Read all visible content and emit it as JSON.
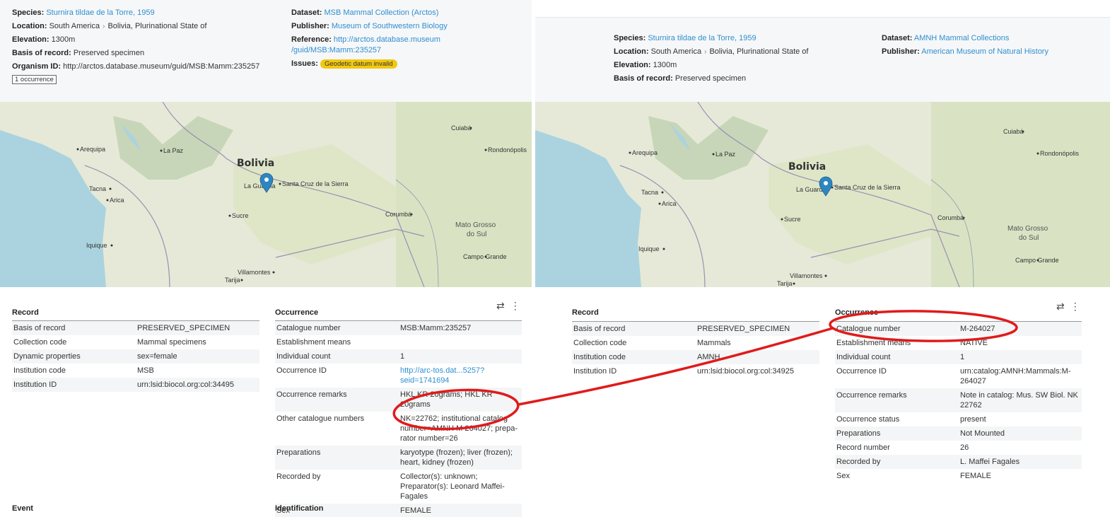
{
  "left": {
    "summary": {
      "species_label": "Species:",
      "species_value": "Sturnira tildae de la Torre, 1959",
      "location_label": "Location:",
      "location_continent": "South America",
      "location_country": "Bolivia, Plurinational State of",
      "elevation_label": "Elevation:",
      "elevation_value": "1300m",
      "basis_label": "Basis of record:",
      "basis_value": "Preserved specimen",
      "organism_label": "Organism ID:",
      "organism_value": "http://arctos.database.museum/guid/MSB:Mamm:235257",
      "count_badge": "1 occurrence",
      "dataset_label": "Dataset:",
      "dataset_value": "MSB Mammal Collection (Arctos)",
      "publisher_label": "Publisher:",
      "publisher_value": "Museum of Southwestern Biology",
      "reference_label": "Reference:",
      "reference_line1": "http://arctos.database.museum",
      "reference_line2": "/guid/MSB:Mamm:235257",
      "issues_label": "Issues:",
      "issue_badge": "Geodetic datum invalid"
    },
    "record": {
      "title": "Record",
      "rows": [
        {
          "k": "Basis of record",
          "v": "PRESERVED_SPECIMEN"
        },
        {
          "k": "Collection code",
          "v": "Mammal specimens"
        },
        {
          "k": "Dynamic properties",
          "v": "sex=female"
        },
        {
          "k": "Institution code",
          "v": "MSB"
        },
        {
          "k": "Institution ID",
          "v": "urn:lsid:biocol.org:col:34495"
        }
      ]
    },
    "occurrence": {
      "title": "Occurrence",
      "rows": [
        {
          "k": "Catalogue number",
          "v": "MSB:Mamm:235257"
        },
        {
          "k": "Establishment means",
          "v": ""
        },
        {
          "k": "Individual count",
          "v": "1"
        },
        {
          "k": "Occurrence ID",
          "v": "http://arc-tos.dat...5257?seid=1741694",
          "link": true
        },
        {
          "k": "Occurrence remarks",
          "v": "HKL KR 20grams; HKL KR 20grams"
        },
        {
          "k": "Other catalogue numbers",
          "v": "NK=22762; institutional catalog number=AMNH M 264027; prepa-rator number=26"
        },
        {
          "k": "Preparations",
          "v": "karyotype (frozen); liver (frozen); heart, kidney (frozen)"
        },
        {
          "k": "Recorded by",
          "v": "Collector(s): unknown; Preparator(s): Leonard Maffei-Fagales"
        },
        {
          "k": "Sex",
          "v": "FEMALE"
        }
      ]
    },
    "event_title": "Event",
    "identification_title": "Identification"
  },
  "right": {
    "summary": {
      "species_label": "Species:",
      "species_value": "Sturnira tildae de la Torre, 1959",
      "location_label": "Location:",
      "location_continent": "South America",
      "location_country": "Bolivia, Plurinational State of",
      "elevation_label": "Elevation:",
      "elevation_value": "1300m",
      "basis_label": "Basis of record:",
      "basis_value": "Preserved specimen",
      "dataset_label": "Dataset:",
      "dataset_value": "AMNH Mammal Collections",
      "publisher_label": "Publisher:",
      "publisher_value": "American Museum of Natural History"
    },
    "record": {
      "title": "Record",
      "rows": [
        {
          "k": "Basis of record",
          "v": "PRESERVED_SPECIMEN"
        },
        {
          "k": "Collection code",
          "v": "Mammals"
        },
        {
          "k": "Institution code",
          "v": "AMNH"
        },
        {
          "k": "Institution ID",
          "v": "urn:lsid:biocol.org:col:34925"
        }
      ]
    },
    "occurrence": {
      "title": "Occurrence",
      "rows": [
        {
          "k": "Catalogue number",
          "v": "M-264027"
        },
        {
          "k": "Establishment means",
          "v": "NATIVE"
        },
        {
          "k": "Individual count",
          "v": "1"
        },
        {
          "k": "Occurrence ID",
          "v": "urn:catalog:AMNH:Mammals:M-264027"
        },
        {
          "k": "Occurrence remarks",
          "v": "Note in catalog: Mus. SW Biol. NK 22762"
        },
        {
          "k": "Occurrence status",
          "v": "present"
        },
        {
          "k": "Preparations",
          "v": "Not Mounted"
        },
        {
          "k": "Record number",
          "v": "26"
        },
        {
          "k": "Recorded by",
          "v": "L. Maffei Fagales"
        },
        {
          "k": "Sex",
          "v": "FEMALE"
        }
      ]
    }
  },
  "map": {
    "country_label": "Bolivia",
    "cities": [
      "Cuiabá",
      "Arequipa",
      "La Paz",
      "Rondonópolis",
      "Tacna",
      "La Guardia",
      "Santa Cruz de la Sierra",
      "Arica",
      "Sucre",
      "Corumbá",
      "Mato Grosso",
      "do Sul",
      "Iquique",
      "Campo Grande",
      "Villamontes",
      "Tarija"
    ],
    "marker_color": "#2e86c1",
    "water_color": "#aad3df"
  },
  "icons": {
    "compare": "swap-arrows-icon",
    "menu": "kebab-menu-icon"
  },
  "annotation_color": "#e01b1b"
}
